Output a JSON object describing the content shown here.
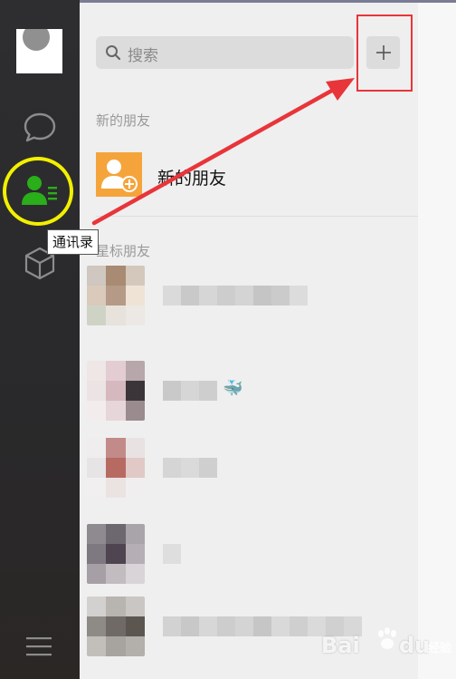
{
  "sidebar": {
    "tooltip": "通讯录",
    "icons": [
      "chat-icon",
      "contacts-icon",
      "box-icon",
      "menu-icon"
    ],
    "active_color": "#2aae1a",
    "highlight_color": "#f2f000"
  },
  "search": {
    "placeholder": "搜索"
  },
  "add_button": {
    "symbol": "+"
  },
  "sections": {
    "new_friends_header": "新的朋友",
    "new_friends_item": "新的朋友",
    "starred_header": "星标朋友"
  },
  "annotation": {
    "arrow_color": "#e8353a"
  },
  "watermark": {
    "left": "Bai",
    "right": "du",
    "sub": "经验"
  }
}
